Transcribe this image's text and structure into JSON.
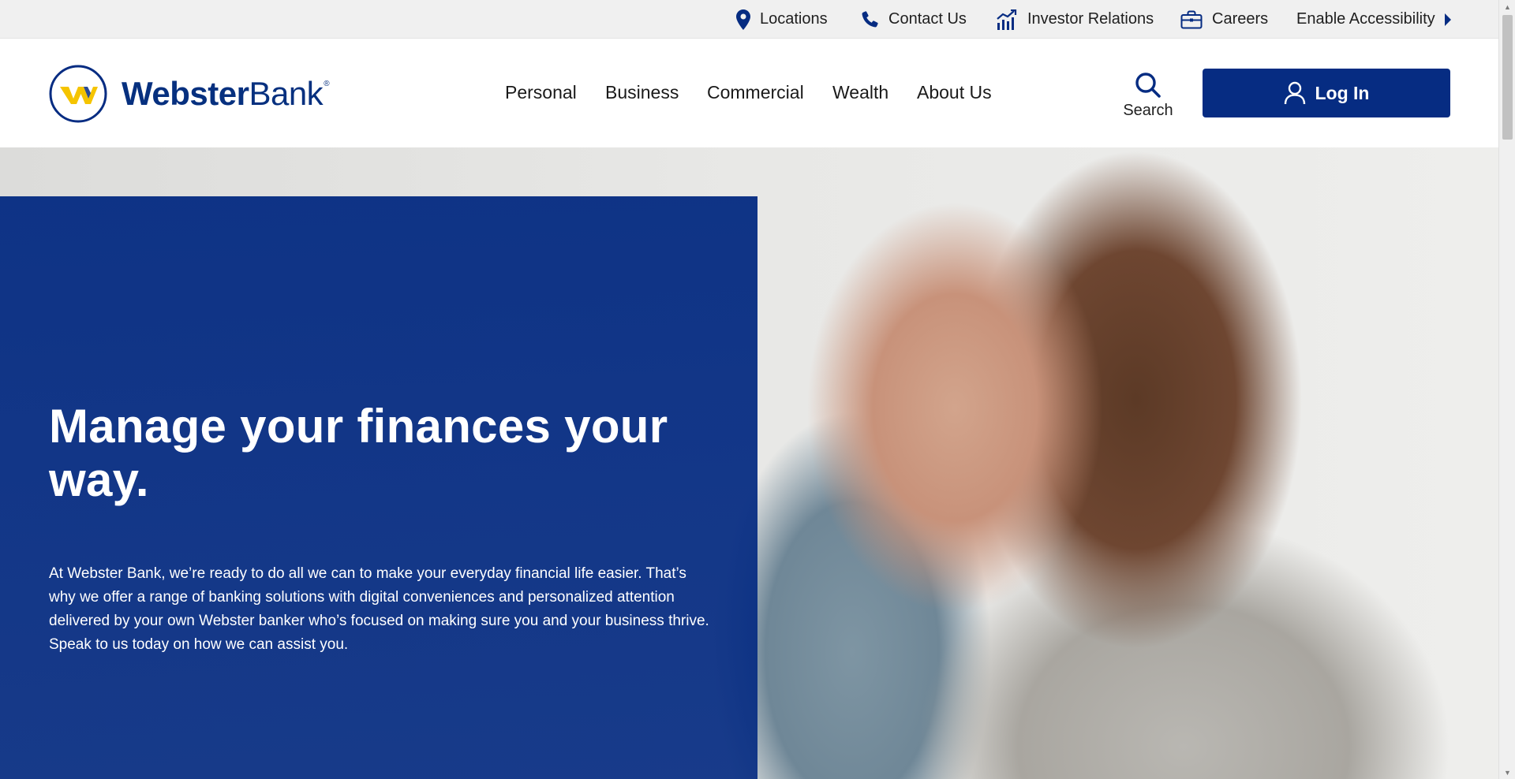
{
  "utility_nav": {
    "locations": "Locations",
    "contact": "Contact Us",
    "investor": "Investor Relations",
    "careers": "Careers",
    "accessibility": "Enable Accessibility"
  },
  "brand": {
    "name_bold": "Webster",
    "name_regular": "Bank",
    "trademark": "®",
    "primary_color": "#062c82",
    "accent_color": "#f5c400"
  },
  "main_nav": {
    "items": [
      {
        "label": "Personal"
      },
      {
        "label": "Business"
      },
      {
        "label": "Commercial"
      },
      {
        "label": "Wealth"
      },
      {
        "label": "About Us"
      }
    ]
  },
  "search": {
    "label": "Search",
    "icon": "search-icon"
  },
  "login": {
    "label": "Log In",
    "icon": "user-icon"
  },
  "hero": {
    "heading": "Manage your finances your way.",
    "body": "At Webster Bank, we’re ready to do all we can to make your everyday financial life easier. That’s why we offer a range of banking solutions with digital conveniences and personalized attention delivered by your own Webster banker who’s focused on making sure you and your business thrive. Speak to us today on how we can assist you."
  }
}
